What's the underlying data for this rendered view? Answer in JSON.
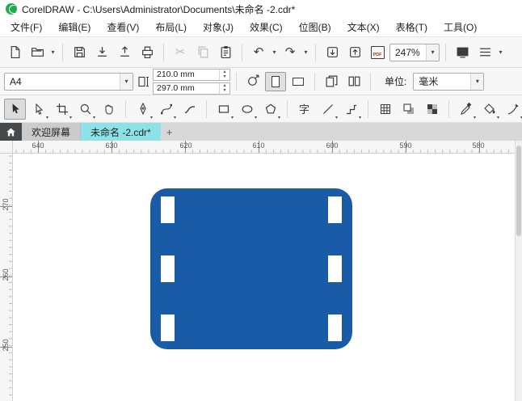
{
  "title_bar": {
    "title": "CorelDRAW - C:\\Users\\Administrator\\Documents\\未命名 -2.cdr*"
  },
  "menu_bar": {
    "items": [
      {
        "label": "文件(F)"
      },
      {
        "label": "编辑(E)"
      },
      {
        "label": "查看(V)"
      },
      {
        "label": "布局(L)"
      },
      {
        "label": "对象(J)"
      },
      {
        "label": "效果(C)"
      },
      {
        "label": "位图(B)"
      },
      {
        "label": "文本(X)"
      },
      {
        "label": "表格(T)"
      },
      {
        "label": "工具(O)"
      }
    ]
  },
  "toolbar": {
    "zoom_level": "247%",
    "pdf_label": "PDF"
  },
  "property_bar": {
    "preset": "A4",
    "page_width": "210.0 mm",
    "page_height": "297.0 mm",
    "units_label": "单位:",
    "units_value": "毫米"
  },
  "toolbox": {
    "text_tool_label": "字"
  },
  "tab_bar": {
    "welcome_tab": "欢迎屏幕",
    "document_tab": "未命名 -2.cdr*",
    "new_tab": "+"
  },
  "rulers": {
    "horizontal_labels": [
      "640",
      "630",
      "620",
      "610",
      "600",
      "590",
      "580"
    ],
    "vertical_labels": [
      "270",
      "260",
      "250"
    ]
  },
  "icons": {
    "undo": "↶",
    "redo": "↷",
    "cut": "✂",
    "caret_down": "▾",
    "spinner_up": "▴",
    "spinner_down": "▾"
  },
  "canvas": {
    "shape": {
      "type": "rounded-rectangle-film-strip",
      "fill": "#1a5ba8",
      "hole_fill": "#ffffff"
    }
  }
}
